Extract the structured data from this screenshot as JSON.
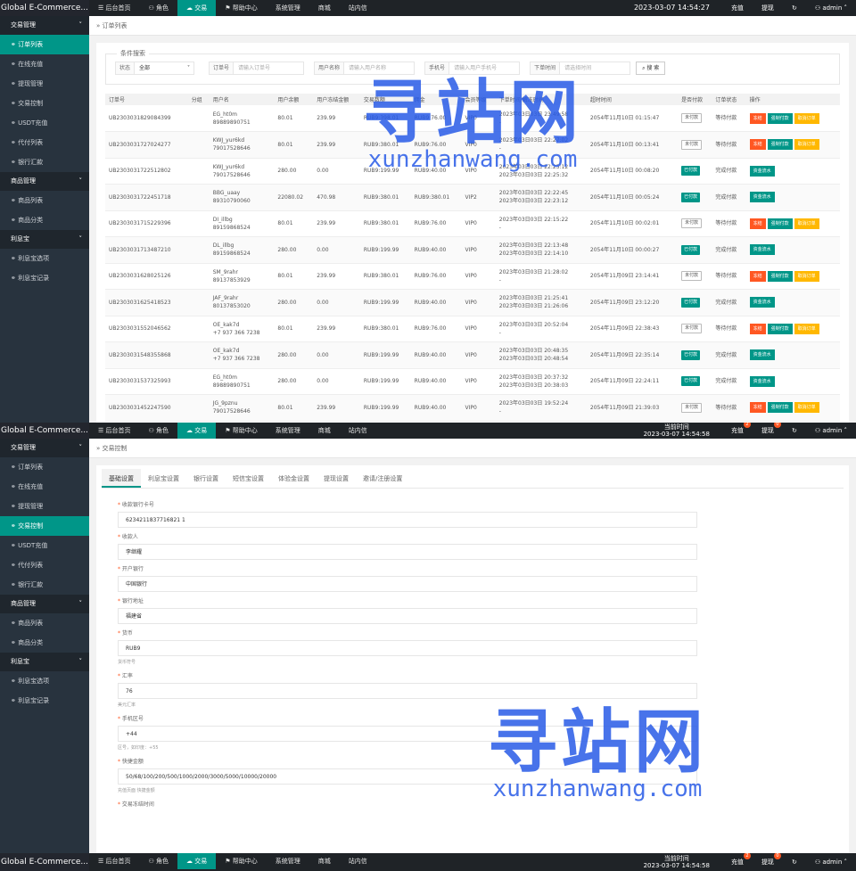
{
  "app_title": "Global E-Commerce...",
  "nav": [
    {
      "label": "后台首页",
      "icon": "menu-icon"
    },
    {
      "label": "角色",
      "icon": "user-icon"
    },
    {
      "label": "交易",
      "icon": "cloud-icon"
    },
    {
      "label": "帮助中心",
      "icon": "flag-icon"
    },
    {
      "label": "系统管理"
    },
    {
      "label": "商城"
    },
    {
      "label": "站内信"
    }
  ],
  "topbar": {
    "time_label": "当前时间",
    "time_s1": "2023-03-07 14:54:27",
    "time_s2": "2023-03-07 14:54:58",
    "recharge_label": "充值",
    "recharge_badge": "2",
    "withdraw_label": "提现",
    "withdraw_badge": "0",
    "refresh_icon": "refresh-icon",
    "user_label": "admin"
  },
  "sidebar": {
    "groups": [
      {
        "label": "交易管理",
        "items": [
          "订单列表",
          "在线充值",
          "提现管理",
          "交易控制",
          "USDT充值",
          "代付列表",
          "银行汇款"
        ]
      },
      {
        "label": "商品管理",
        "items": [
          "商品列表",
          "商品分类"
        ]
      },
      {
        "label": "利息宝",
        "items": [
          "利息宝选项",
          "利息宝记录"
        ]
      }
    ],
    "s1_active": "订单列表",
    "s2_active": "交易控制"
  },
  "orders": {
    "breadcrumb": "订单列表",
    "search_legend": "条件搜索",
    "search": {
      "status_label": "状态",
      "status_value": "全部",
      "order_label": "订单号",
      "order_ph": "请输入订单号",
      "username_label": "用户名称",
      "username_ph": "请输入用户名称",
      "phone_label": "手机号",
      "phone_ph": "请输入用户手机号",
      "time_label": "下单时间",
      "time_ph": "请选择时间",
      "button": "搜 索"
    },
    "columns": [
      "订单号",
      "分组",
      "用户名",
      "用户余额",
      "用户冻结金额",
      "交易数额",
      "佣金",
      "会员等级",
      "下单时间/解冻时间",
      "超时时间",
      "是否付款",
      "订单状态",
      "操作"
    ],
    "rows": [
      {
        "id": "UB2303031829084399",
        "user": "EG_ht0m",
        "phone": "89889890751",
        "bal": "80.01",
        "frozen": "239.99",
        "amt": "RUB9:398.01",
        "comm": "RUB9:76.00",
        "vip": "VIP0",
        "t1": "2023年03日03日 23:49:58",
        "t2": "-",
        "exp": "2054年11月10日 01:15:47",
        "paid": "未付款",
        "status": "等待付款",
        "acts": [
          "冻结",
          "强制付款",
          "取消订单"
        ]
      },
      {
        "id": "UB2303031727024277",
        "user": "KWJ_yur6kd",
        "phone": "79017528646",
        "bal": "80.01",
        "frozen": "239.99",
        "amt": "RUB9:380.01",
        "comm": "RUB9:76.00",
        "vip": "VIP0",
        "t1": "2023年03日03日 22:27:02",
        "t2": "-",
        "exp": "2054年11月10日 00:13:41",
        "paid": "未付款",
        "status": "等待付款",
        "acts": [
          "冻结",
          "强制付款",
          "取消订单"
        ]
      },
      {
        "id": "UB2303031722512802",
        "user": "KWJ_yur6kd",
        "phone": "79017528646",
        "bal": "280.00",
        "frozen": "0.00",
        "amt": "RUB9:199.99",
        "comm": "RUB9:40.00",
        "vip": "VIP0",
        "t1": "2023年03日03日 22:25:12",
        "t2": "2023年03日03日 22:25:32",
        "exp": "2054年11月10日 00:08:20",
        "paid": "已付款",
        "status": "完成付款",
        "acts": [
          "资金流水"
        ]
      },
      {
        "id": "UB2303031722451718",
        "user": "BBG_uaay",
        "phone": "89310790060",
        "bal": "22080.02",
        "frozen": "470.98",
        "amt": "RUB9:380.01",
        "comm": "RUB9:380.01",
        "vip": "VIP2",
        "t1": "2023年03日03日 22:22:45",
        "t2": "2023年03日03日 22:23:12",
        "exp": "2054年11月10日 00:05:24",
        "paid": "已付款",
        "status": "完成付款",
        "acts": [
          "资金流水"
        ]
      },
      {
        "id": "UB2303031715229396",
        "user": "DI_illbg",
        "phone": "89159868524",
        "bal": "80.01",
        "frozen": "239.99",
        "amt": "RUB9:380.01",
        "comm": "RUB9:76.00",
        "vip": "VIP0",
        "t1": "2023年03日03日 22:15:22",
        "t2": "-",
        "exp": "2054年11月10日 00:02:01",
        "paid": "未付款",
        "status": "等待付款",
        "acts": [
          "冻结",
          "强制付款",
          "取消订单"
        ]
      },
      {
        "id": "UB2303031713487210",
        "user": "DL_illbg",
        "phone": "89159868524",
        "bal": "280.00",
        "frozen": "0.00",
        "amt": "RUB9:199.99",
        "comm": "RUB9:40.00",
        "vip": "VIP0",
        "t1": "2023年03日03日 22:13:48",
        "t2": "2023年03日03日 22:14:10",
        "exp": "2054年11月10日 00:00:27",
        "paid": "已付款",
        "status": "完成付款",
        "acts": [
          "资金流水"
        ]
      },
      {
        "id": "UB2303031628025126",
        "user": "SM_9rahr",
        "phone": "89137853929",
        "bal": "80.01",
        "frozen": "239.99",
        "amt": "RUB9:380.01",
        "comm": "RUB9:76.00",
        "vip": "VIP0",
        "t1": "2023年03日03日 21:28:02",
        "t2": "-",
        "exp": "2054年11月09日 23:14:41",
        "paid": "未付款",
        "status": "等待付款",
        "acts": [
          "冻结",
          "强制付款",
          "取消订单"
        ]
      },
      {
        "id": "UB2303031625418523",
        "user": "JAF_9rahr",
        "phone": "80137853020",
        "bal": "280.00",
        "frozen": "0.00",
        "amt": "RUB9:199.99",
        "comm": "RUB9:40.00",
        "vip": "VIP0",
        "t1": "2023年03日03日 21:25:41",
        "t2": "2023年03日03日 21:26:06",
        "exp": "2054年11月09日 23:12:20",
        "paid": "已付款",
        "status": "完成付款",
        "acts": [
          "资金流水"
        ]
      },
      {
        "id": "UB2303031552046562",
        "user": "OE_kak7d",
        "phone": "+7 937 366 7238",
        "bal": "80.01",
        "frozen": "239.99",
        "amt": "RUB9:380.01",
        "comm": "RUB9:76.00",
        "vip": "VIP0",
        "t1": "2023年03日03日 20:52:04",
        "t2": "-",
        "exp": "2054年11月09日 22:38:43",
        "paid": "未付款",
        "status": "等待付款",
        "acts": [
          "冻结",
          "强制付款",
          "取消订单"
        ]
      },
      {
        "id": "UB2303031548355868",
        "user": "OE_kak7d",
        "phone": "+7 937 366 7238",
        "bal": "280.00",
        "frozen": "0.00",
        "amt": "RUB9:199.99",
        "comm": "RUB9:40.00",
        "vip": "VIP0",
        "t1": "2023年03日03日 20:48:35",
        "t2": "2023年03日03日 20:48:54",
        "exp": "2054年11月09日 22:35:14",
        "paid": "已付款",
        "status": "完成付款",
        "acts": [
          "资金流水"
        ]
      },
      {
        "id": "UB2303031537325993",
        "user": "EG_ht0m",
        "phone": "89889890751",
        "bal": "280.00",
        "frozen": "0.00",
        "amt": "RUB9:199.99",
        "comm": "RUB9:40.00",
        "vip": "VIP0",
        "t1": "2023年03日03日 20:37:32",
        "t2": "2023年03日03日 20:38:03",
        "exp": "2054年11月09日 22:24:11",
        "paid": "已付款",
        "status": "完成付款",
        "acts": [
          "资金流水"
        ]
      },
      {
        "id": "UB2303031452247590",
        "user": "JG_9pznu",
        "phone": "79017528646",
        "bal": "80.01",
        "frozen": "239.99",
        "amt": "RUB9:199.99",
        "comm": "RUB9:40.00",
        "vip": "VIP0",
        "t1": "2023年03日03日 19:52:24",
        "t2": "-",
        "exp": "2054年11月09日 21:39:03",
        "paid": "未付款",
        "status": "等待付款",
        "acts": [
          "冻结",
          "强制付款",
          "取消订单"
        ]
      }
    ]
  },
  "control": {
    "breadcrumb": "交易控制",
    "tabs": [
      "基础设置",
      "利息宝设置",
      "银行设置",
      "短信宝设置",
      "体验金设置",
      "提现设置",
      "邀请/注册设置"
    ],
    "fields": [
      {
        "label": "收款银行卡号",
        "value": "6234211837716821 1",
        "tip": ""
      },
      {
        "label": "收款人",
        "value": "李继耀",
        "tip": ""
      },
      {
        "label": "开户银行",
        "value": "中国银行",
        "tip": ""
      },
      {
        "label": "银行地址",
        "value": "福建省",
        "tip": ""
      },
      {
        "label": "货币",
        "value": "RUB9",
        "tip": "货币符号"
      },
      {
        "label": "汇率",
        "value": "76",
        "tip": "美元汇率"
      },
      {
        "label": "手机区号",
        "value": "+44",
        "tip": "区号，如印度：+55"
      },
      {
        "label": "快捷金额",
        "value": "50/68/100/200/500/1000/2000/3000/5000/10000/20000",
        "tip": "充值页面 快捷金额"
      },
      {
        "label": "交易冻结时间",
        "value": "",
        "tip": ""
      }
    ]
  },
  "watermark": {
    "cn": "寻站网",
    "en": "xunzhanwang.com"
  }
}
